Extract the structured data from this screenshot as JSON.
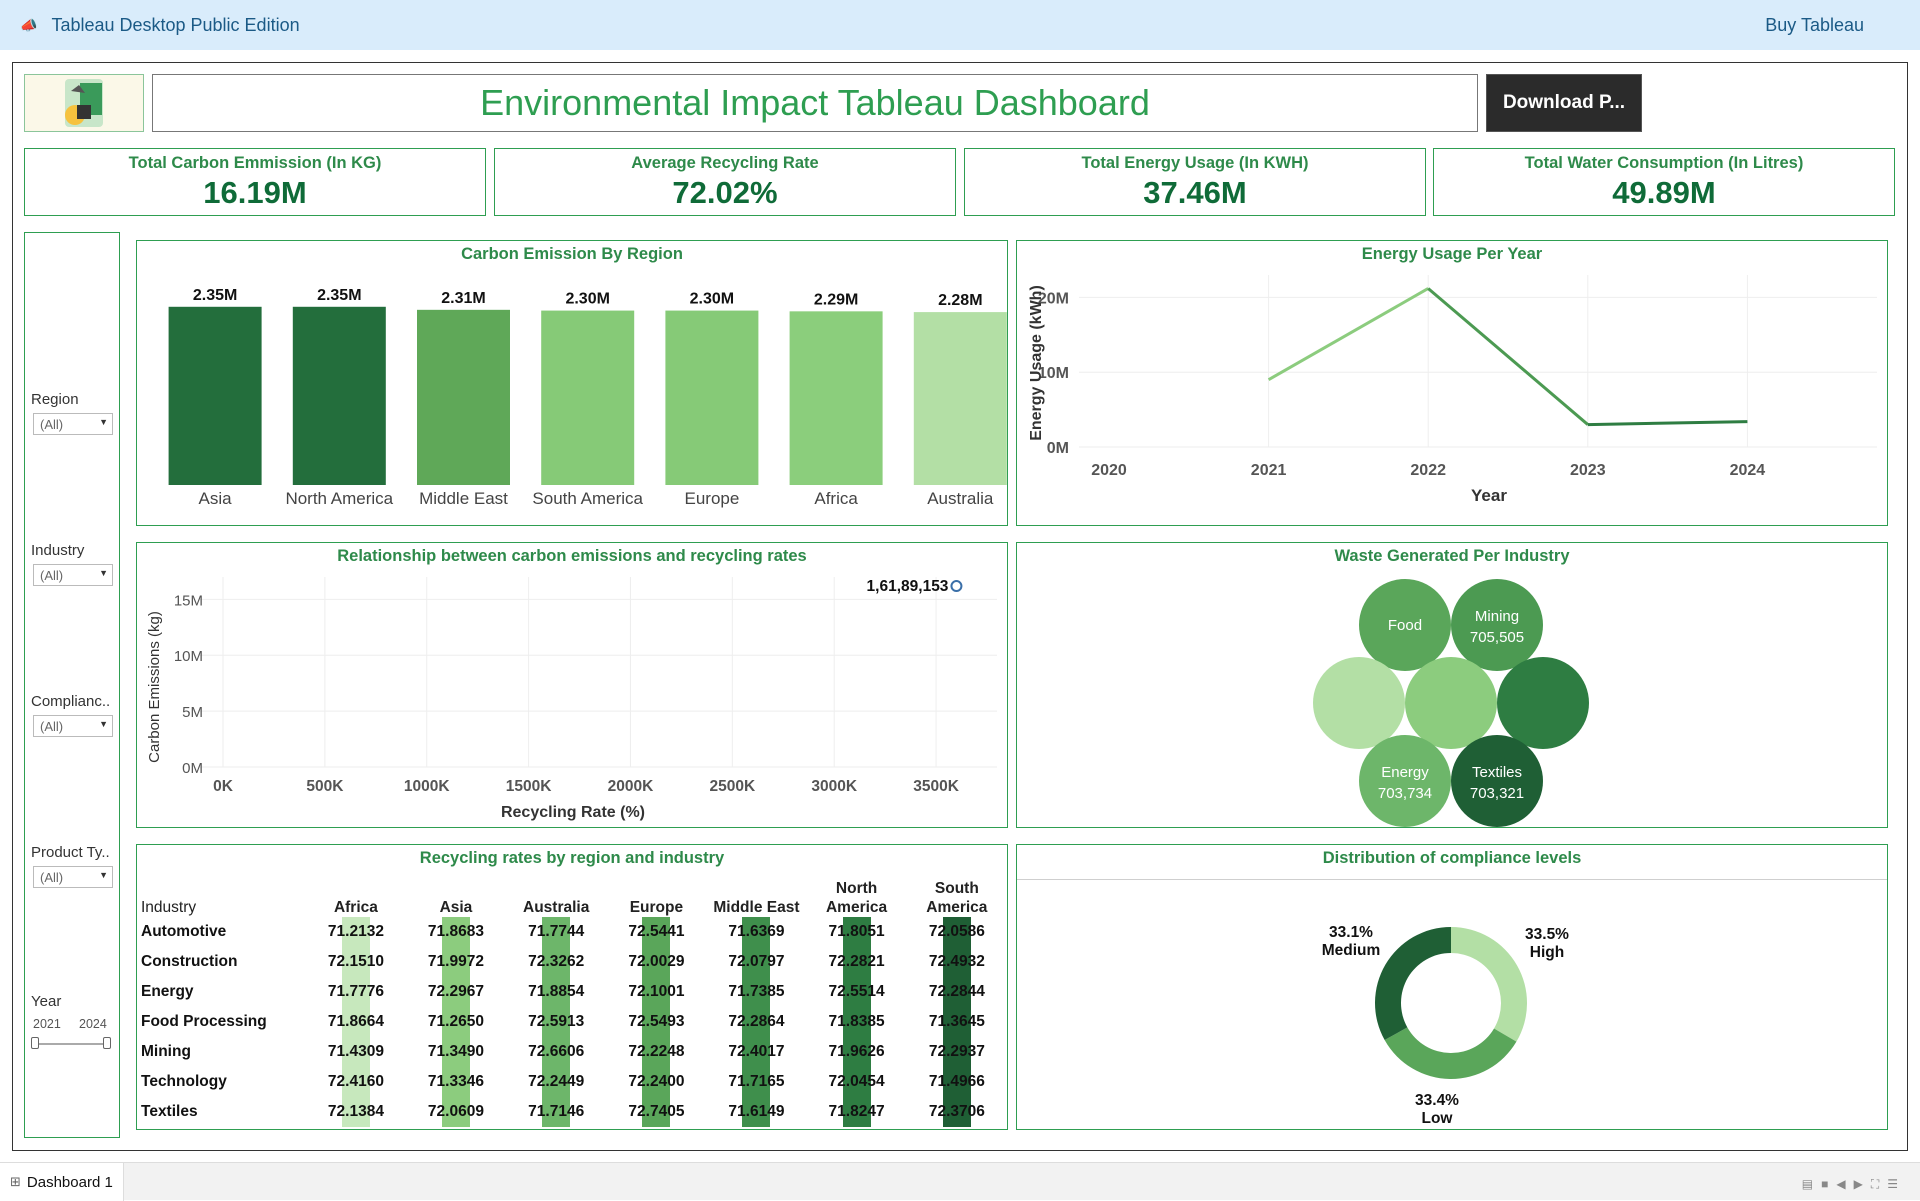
{
  "app": {
    "title": "Tableau Desktop Public Edition",
    "buy": "Buy Tableau"
  },
  "dashboard": {
    "title": "Environmental Impact Tableau Dashboard",
    "download_label": "Download P..."
  },
  "kpis": [
    {
      "label": "Total Carbon Emmission (In KG)",
      "value": "16.19M"
    },
    {
      "label": "Average Recycling Rate",
      "value": "72.02%"
    },
    {
      "label": "Total Energy Usage (In KWH)",
      "value": "37.46M"
    },
    {
      "label": "Total Water Consumption (In Litres)",
      "value": "49.89M"
    }
  ],
  "filters": [
    {
      "label": "Region",
      "value": "(All)"
    },
    {
      "label": "Industry",
      "value": "(All)"
    },
    {
      "label": "Complianc..",
      "value": "(All)"
    },
    {
      "label": "Product Ty..",
      "value": "(All)"
    }
  ],
  "year_filter": {
    "label": "Year",
    "min": "2021",
    "max": "2024"
  },
  "colors": {
    "accent": "#2e9e51",
    "dark": "#0f6b38",
    "palette": [
      "#1e6b3a",
      "#2e7d42",
      "#5aa75a",
      "#7cc47a",
      "#a8d89e",
      "#c7e8bd"
    ]
  },
  "chart_data": [
    {
      "type": "bar",
      "title": "Carbon Emission By Region",
      "categories": [
        "Asia",
        "North America",
        "Middle East",
        "South America",
        "Europe",
        "Africa",
        "Australia"
      ],
      "values": [
        2350000,
        2350000,
        2310000,
        2300000,
        2300000,
        2290000,
        2280000
      ],
      "labels": [
        "2.35M",
        "2.35M",
        "2.31M",
        "2.30M",
        "2.30M",
        "2.29M",
        "2.28M"
      ],
      "colors": [
        "#236e3c",
        "#236e3c",
        "#5fa858",
        "#86ca77",
        "#86ca77",
        "#8bce7c",
        "#b3dfa5"
      ]
    },
    {
      "type": "line",
      "title": "Energy Usage Per Year",
      "xlabel": "Year",
      "ylabel": "Energy Usage (kWh)",
      "x": [
        2021,
        2022,
        2023,
        2024
      ],
      "values": [
        9000000,
        21200000,
        3000000,
        3400000
      ],
      "xticks": [
        "2020",
        "2021",
        "2022",
        "2023",
        "2024",
        "2025"
      ],
      "yticks": [
        "0M",
        "10M",
        "20M"
      ],
      "ylim": [
        0,
        23000000
      ]
    },
    {
      "type": "scatter",
      "title": "Relationship between carbon emissions and recycling rates",
      "xlabel": "Recycling Rate (%)",
      "ylabel": "Carbon Emissions (kg)",
      "points": [
        {
          "x": 3600000,
          "y": 16189153,
          "label": "1,61,89,153"
        }
      ],
      "xticks": [
        "0K",
        "500K",
        "1000K",
        "1500K",
        "2000K",
        "2500K",
        "3000K",
        "3500K"
      ],
      "yticks": [
        "0M",
        "5M",
        "10M",
        "15M"
      ],
      "xlim": [
        0,
        3750000
      ],
      "ylim": [
        0,
        17000000
      ]
    },
    {
      "type": "bubble",
      "title": "Waste Generated Per Industry",
      "bubbles": [
        {
          "name": "Food",
          "value": "",
          "color": "#5aa65a"
        },
        {
          "name": "Mining",
          "value": "705,505",
          "color": "#4c9a52"
        },
        {
          "name": "",
          "value": "",
          "color": "#b3dfa5"
        },
        {
          "name": "",
          "value": "",
          "color": "#8ccc7e"
        },
        {
          "name": "",
          "value": "",
          "color": "#2e7d42"
        },
        {
          "name": "Energy",
          "value": "703,734",
          "color": "#6db66a"
        },
        {
          "name": "Textiles",
          "value": "703,321",
          "color": "#1f5f35"
        }
      ]
    },
    {
      "type": "heatmap",
      "title": "Recycling rates by region and industry",
      "row_header": "Industry",
      "columns": [
        [
          "",
          "Africa"
        ],
        [
          "",
          "Asia"
        ],
        [
          "",
          "Australia"
        ],
        [
          "",
          "Europe"
        ],
        [
          "",
          "Middle East"
        ],
        [
          "North",
          "America"
        ],
        [
          "South",
          "America"
        ]
      ],
      "rows": [
        {
          "name": "Automotive",
          "values": [
            "71.2132",
            "71.8683",
            "71.7744",
            "72.5441",
            "71.6369",
            "71.8051",
            "72.0586"
          ]
        },
        {
          "name": "Construction",
          "values": [
            "72.1510",
            "71.9972",
            "72.3262",
            "72.0029",
            "72.0797",
            "72.2821",
            "72.4932"
          ]
        },
        {
          "name": "Energy",
          "values": [
            "71.7776",
            "72.2967",
            "71.8854",
            "72.1001",
            "71.7385",
            "72.5514",
            "72.2844"
          ]
        },
        {
          "name": "Food Processing",
          "values": [
            "71.8664",
            "71.2650",
            "72.5913",
            "72.5493",
            "72.2864",
            "71.8385",
            "71.3645"
          ]
        },
        {
          "name": "Mining",
          "values": [
            "71.4309",
            "71.3490",
            "72.6606",
            "72.2248",
            "72.4017",
            "71.9626",
            "72.2937"
          ]
        },
        {
          "name": "Technology",
          "values": [
            "72.4160",
            "71.3346",
            "72.2449",
            "72.2400",
            "71.7165",
            "72.0454",
            "71.4966"
          ]
        },
        {
          "name": "Textiles",
          "values": [
            "72.1384",
            "72.0609",
            "71.7146",
            "72.7405",
            "71.6149",
            "71.8247",
            "72.3706"
          ]
        }
      ],
      "column_colors": [
        "#c7e8bd",
        "#8ccc7e",
        "#6db66a",
        "#5aa65a",
        "#3f8f4c",
        "#2e7d42",
        "#1f5f35"
      ]
    },
    {
      "type": "pie",
      "title": "Distribution of compliance levels",
      "slices": [
        {
          "label": "High",
          "pct": "33.5%",
          "value": 33.5,
          "color": "#b3dfa5"
        },
        {
          "label": "Low",
          "pct": "33.4%",
          "value": 33.4,
          "color": "#5aa65a"
        },
        {
          "label": "Medium",
          "pct": "33.1%",
          "value": 33.1,
          "color": "#1f5f35"
        }
      ]
    }
  ],
  "bottom": {
    "tab": "Dashboard 1"
  }
}
